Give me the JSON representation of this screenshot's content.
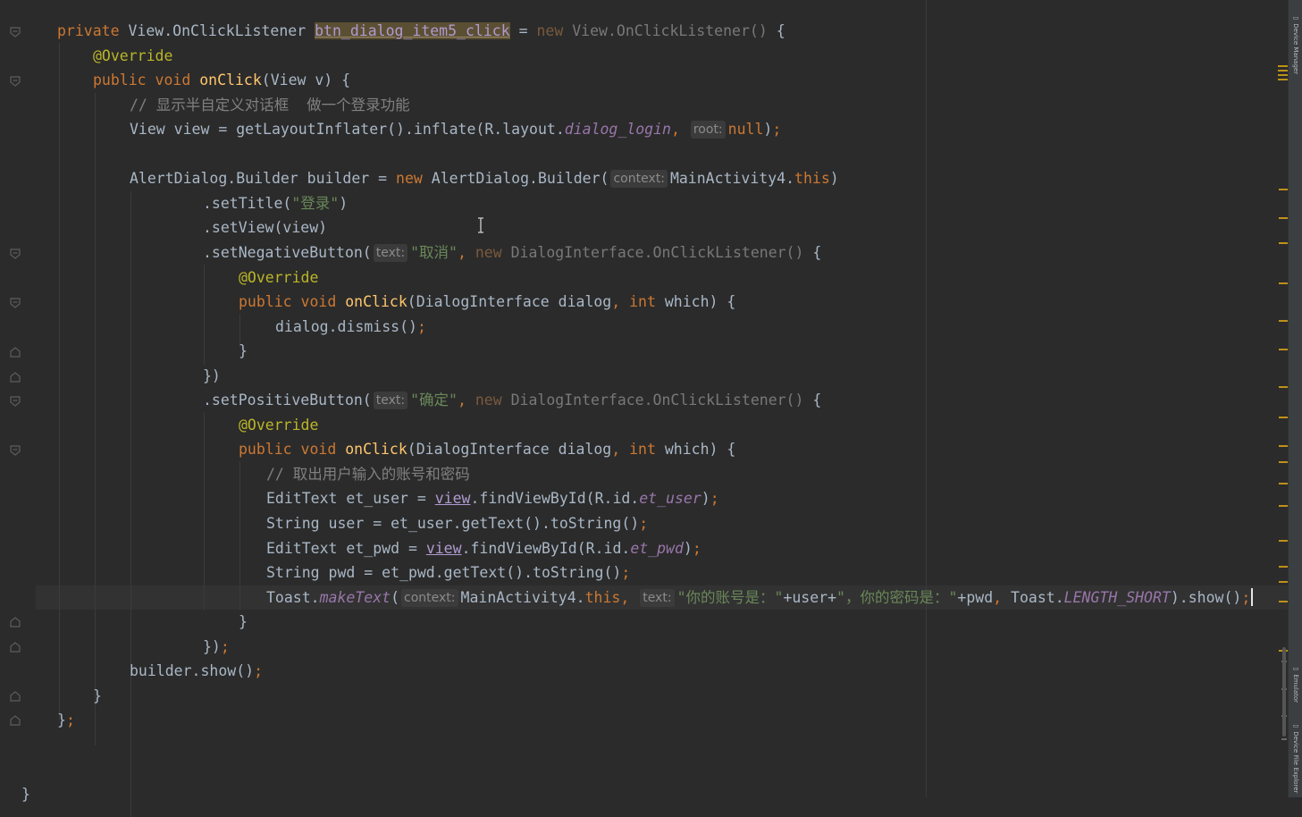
{
  "editor": {
    "lines": [
      [
        [
          "kw",
          "private "
        ],
        [
          "pl",
          "View.OnClickListener "
        ],
        [
          "hl",
          "btn_dialog_item5_click"
        ],
        [
          "pl",
          " = "
        ],
        [
          "dimk",
          "new "
        ],
        [
          "dim",
          "View.OnClickListener() "
        ],
        [
          "pl",
          "{"
        ]
      ],
      [
        [
          "ann",
          "@Override"
        ]
      ],
      [
        [
          "kw",
          "public void "
        ],
        [
          "fn",
          "onClick"
        ],
        [
          "pl",
          "(View v) {"
        ]
      ],
      [
        [
          "cmt",
          "// 显示半自定义对话框  做一个登录功能"
        ]
      ],
      [
        [
          "pl",
          "View view = getLayoutInflater().inflate(R.layout."
        ],
        [
          "ital",
          "dialog_login"
        ],
        [
          "kw",
          ", "
        ],
        [
          "hint",
          "root:"
        ],
        [
          "kw",
          "null"
        ],
        [
          "pl",
          ")"
        ],
        [
          "kw",
          ";"
        ]
      ],
      [],
      [
        [
          "pl",
          "AlertDialog.Builder builder = "
        ],
        [
          "kw",
          "new "
        ],
        [
          "pl",
          "AlertDialog.Builder("
        ],
        [
          "hint",
          "context:"
        ],
        [
          "pl",
          "MainActivity4."
        ],
        [
          "kw",
          "this"
        ],
        [
          "pl",
          ")"
        ]
      ],
      [
        [
          "pl",
          ".setTitle("
        ],
        [
          "str",
          "\"登录\""
        ],
        [
          "pl",
          ")"
        ]
      ],
      [
        [
          "pl",
          ".setView(view)"
        ]
      ],
      [
        [
          "pl",
          ".setNegativeButton("
        ],
        [
          "hint",
          "text:"
        ],
        [
          "str",
          "\"取消\""
        ],
        [
          "kw",
          ", "
        ],
        [
          "dimk",
          "new "
        ],
        [
          "dim",
          "DialogInterface.OnClickListener() "
        ],
        [
          "pl",
          "{"
        ]
      ],
      [
        [
          "ann",
          "@Override"
        ]
      ],
      [
        [
          "kw",
          "public void "
        ],
        [
          "fn",
          "onClick"
        ],
        [
          "pl",
          "(DialogInterface dialog"
        ],
        [
          "kw",
          ", int "
        ],
        [
          "pl",
          "which) {"
        ]
      ],
      [
        [
          "pl",
          "dialog.dismiss()"
        ],
        [
          "kw",
          ";"
        ]
      ],
      [
        [
          "pl",
          "}"
        ]
      ],
      [
        [
          "pl",
          "})"
        ]
      ],
      [
        [
          "pl",
          ".setPositiveButton("
        ],
        [
          "hint",
          "text:"
        ],
        [
          "str",
          "\"确定\""
        ],
        [
          "kw",
          ", "
        ],
        [
          "dimk",
          "new "
        ],
        [
          "dim",
          "DialogInterface.OnClickListener() "
        ],
        [
          "pl",
          "{"
        ]
      ],
      [
        [
          "ann",
          "@Override"
        ]
      ],
      [
        [
          "kw",
          "public void "
        ],
        [
          "fn",
          "onClick"
        ],
        [
          "pl",
          "(DialogInterface dialog"
        ],
        [
          "kw",
          ", int "
        ],
        [
          "pl",
          "which) {"
        ]
      ],
      [
        [
          "cmt",
          "// 取出用户输入的账号和密码"
        ]
      ],
      [
        [
          "pl",
          "EditText et_user = "
        ],
        [
          "und",
          "view"
        ],
        [
          "pl",
          ".findViewById(R.id."
        ],
        [
          "ital",
          "et_user"
        ],
        [
          "pl",
          ")"
        ],
        [
          "kw",
          ";"
        ]
      ],
      [
        [
          "pl",
          "String user = et_user.getText().toString()"
        ],
        [
          "kw",
          ";"
        ]
      ],
      [
        [
          "pl",
          "EditText et_pwd = "
        ],
        [
          "und",
          "view"
        ],
        [
          "pl",
          ".findViewById(R.id."
        ],
        [
          "ital",
          "et_pwd"
        ],
        [
          "pl",
          ")"
        ],
        [
          "kw",
          ";"
        ]
      ],
      [
        [
          "pl",
          "String pwd = et_pwd.getText().toString()"
        ],
        [
          "kw",
          ";"
        ]
      ],
      [
        [
          "pl",
          "Toast."
        ],
        [
          "ital",
          "makeText"
        ],
        [
          "pl",
          "("
        ],
        [
          "hint",
          "context:"
        ],
        [
          "pl",
          "MainActivity4."
        ],
        [
          "kw",
          "this, "
        ],
        [
          "hint",
          "text:"
        ],
        [
          "str",
          "\"你的账号是：\""
        ],
        [
          "pl",
          "+user+"
        ],
        [
          "str",
          "\"，你的密码是：\""
        ],
        [
          "pl",
          "+pwd"
        ],
        [
          "kw",
          ", "
        ],
        [
          "pl",
          "Toast."
        ],
        [
          "ital",
          "LENGTH_SHORT"
        ],
        [
          "pl",
          ").show()"
        ],
        [
          "kw",
          ";"
        ]
      ],
      [
        [
          "pl",
          "}"
        ]
      ],
      [
        [
          "pl",
          "})"
        ],
        [
          "kw",
          ";"
        ]
      ],
      [
        [
          "pl",
          "builder.show()"
        ],
        [
          "kw",
          ";"
        ]
      ],
      [
        [
          "pl",
          "}"
        ]
      ],
      [
        [
          "pl",
          "}"
        ],
        [
          "kw",
          ";"
        ]
      ],
      [],
      [],
      [
        [
          "pl",
          "}"
        ]
      ]
    ]
  },
  "tool_window_tabs": [
    "Device Manager",
    "Emulator",
    "Device File Explorer"
  ]
}
